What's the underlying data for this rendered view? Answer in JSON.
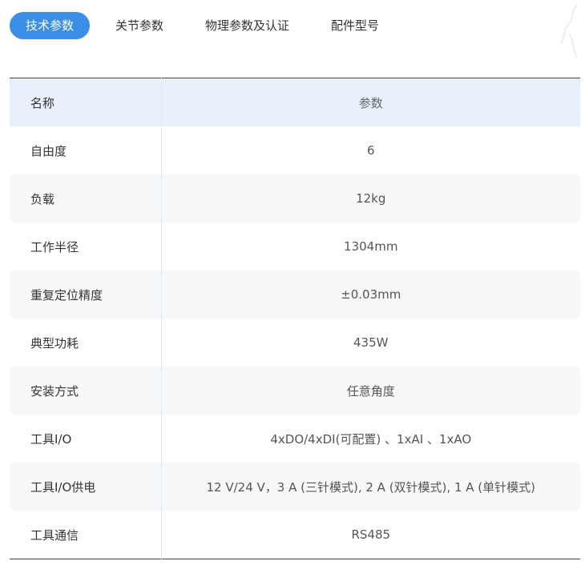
{
  "tabs": [
    {
      "label": "技术参数",
      "active": true
    },
    {
      "label": "关节参数",
      "active": false
    },
    {
      "label": "物理参数及认证",
      "active": false
    },
    {
      "label": "配件型号",
      "active": false
    }
  ],
  "table": {
    "header": {
      "name": "名称",
      "value": "参数"
    },
    "rows": [
      {
        "name": "自由度",
        "value": "6"
      },
      {
        "name": "负载",
        "value": "12kg"
      },
      {
        "name": "工作半径",
        "value": "1304mm"
      },
      {
        "name": "重复定位精度",
        "value": "±0.03mm"
      },
      {
        "name": "典型功耗",
        "value": "435W"
      },
      {
        "name": "安装方式",
        "value": "任意角度"
      },
      {
        "name": "工具I/O",
        "value": "4xDO/4xDI(可配置) 、1xAI 、1xAO"
      },
      {
        "name": "工具I/O供电",
        "value": "12 V/24 V，3 A (三针模式), 2 A (双针模式), 1 A (单针模式)"
      },
      {
        "name": "工具通信",
        "value": "RS485"
      }
    ]
  },
  "colors": {
    "accent": "#3a8ee6",
    "header_row": "#e7f0fb",
    "striped_row": "#f7f8fa"
  }
}
